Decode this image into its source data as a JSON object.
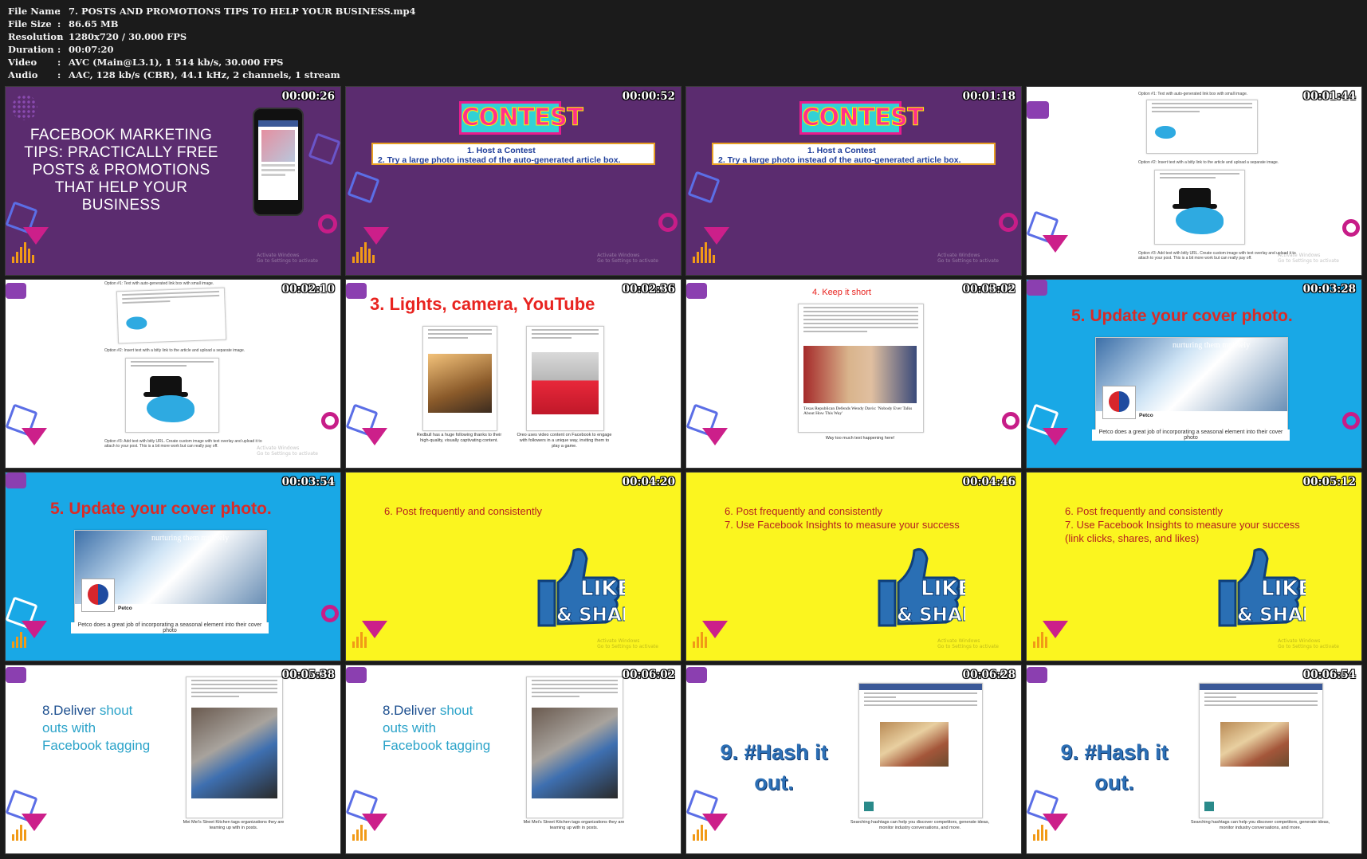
{
  "meta": {
    "rows": [
      {
        "key": "File Name",
        "value": "7. POSTS AND PROMOTIONS TIPS TO HELP YOUR BUSINESS.mp4"
      },
      {
        "key": "File Size",
        "value": "86.65 MB"
      },
      {
        "key": "Resolution",
        "value": "1280x720 / 30.000 FPS"
      },
      {
        "key": "Duration",
        "value": "00:07:20"
      },
      {
        "key": "Video",
        "value": "AVC (Main@L3.1), 1 514 kb/s, 30.000 FPS"
      },
      {
        "key": "Audio",
        "value": "AAC, 128 kb/s (CBR), 44.1 kHz, 2 channels, 1 stream"
      }
    ],
    "separator": ":"
  },
  "tiles": [
    {
      "ts": "00:00:26",
      "title": "FACEBOOK MARKETING TIPS: PRACTICALLY FREE POSTS & PROMOTIONS THAT HELP  YOUR BUSINESS"
    },
    {
      "ts": "00:00:52",
      "contest": "CONTEST",
      "item1": "1.  Host a Contest",
      "item2": "2.  Try a large photo instead of the auto-generated article box."
    },
    {
      "ts": "00:01:18",
      "contest": "CONTEST",
      "item1": "1.  Host a Contest",
      "item2": "2.  Try a large photo instead of the auto-generated article box."
    },
    {
      "ts": "00:01:44",
      "opt1": "Option #1: Text with auto-generated link box with small image.",
      "opt2": "Option #2: Insert text with a bitly link to the article and upload a separate image.",
      "opt3": "Option #3: Add text with bitly URL. Create custom image with text overlay and upload it to attach to your post. This is a bit more work but can really pay off."
    },
    {
      "ts": "00:02:10",
      "opt1": "Option #1: Text with auto-generated link box with small image.",
      "opt2": "Option #2: Insert text with a bitly link to the article and upload a separate image.",
      "opt3": "Option #3: Add text with bitly URL. Create custom image with text overlay and upload it to attach to your post. This is a bit more work but can really pay off."
    },
    {
      "ts": "00:02:36",
      "heading": "3. Lights, camera, YouTube",
      "cap1": "Redbull has a huge following thanks to their high-quality, visually captivating content.",
      "cap2": "Oreo uses video content on Facebook to engage with followers in a unique way, inviting them to play a game."
    },
    {
      "ts": "00:03:02",
      "heading": "4. Keep it short",
      "post_title": "Texas Republican Defends Wendy Davis: 'Nobody Ever Talks About How This Way'",
      "caption": "Way too much text happening here!"
    },
    {
      "ts": "00:03:28",
      "heading": "5. Update your cover photo.",
      "cover_text": "nurturing them   mpletely",
      "brand": "Petco",
      "caption": "Petco does a great job of incorporating a seasonal element into their cover photo"
    },
    {
      "ts": "00:03:54",
      "heading": "5. Update your cover photo.",
      "cover_text": "nurturing them   mpletely",
      "brand": "Petco",
      "caption": "Petco does a great job of incorporating a seasonal element into their cover photo"
    },
    {
      "ts": "00:04:20",
      "lines": [
        "6. Post frequently and consistently"
      ],
      "like1": "LIKE",
      "like2": "& SHARE"
    },
    {
      "ts": "00:04:46",
      "lines": [
        "6. Post frequently and consistently",
        "7. Use Facebook Insights to measure your success"
      ],
      "like1": "LIKE",
      "like2": "& SHARE"
    },
    {
      "ts": "00:05:12",
      "lines": [
        "6. Post frequently and consistently",
        "7. Use Facebook Insights to measure your success",
        "(link clicks, shares, and likes)"
      ],
      "like1": "LIKE",
      "like2": "& SHARE"
    },
    {
      "ts": "00:05:38",
      "h1": "8.Deliver ",
      "h1b": "shout",
      "h2": "outs with",
      "h3": "Facebook tagging",
      "caption": "Mei Mei's Street Kitchen tags organizations they are teaming up with in posts."
    },
    {
      "ts": "00:06:02",
      "h1": "8.Deliver ",
      "h1b": "shout",
      "h2": "outs with",
      "h3": "Facebook tagging",
      "caption": "Mei Mei's Street Kitchen tags organizations they are teaming up with in posts."
    },
    {
      "ts": "00:06:28",
      "h1": "9. #Hash it",
      "h2": "out.",
      "caption": "Searching hashtags can help you discover competitors, generate ideas, monitor industry conversations, and more."
    },
    {
      "ts": "00:06:54",
      "h1": "9. #Hash it",
      "h2": "out.",
      "caption": "Searching hashtags can help you discover competitors, generate ideas, monitor industry conversations, and more."
    }
  ],
  "colors": {
    "purple": "#5b2c6f",
    "blue": "#19a8e6",
    "yellow": "#fbf51f",
    "magenta": "#cc1f8a"
  }
}
